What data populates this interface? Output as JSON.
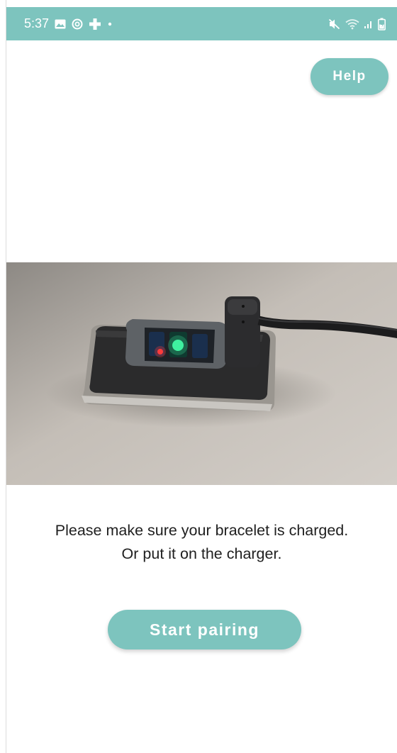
{
  "status_bar": {
    "time": "5:37",
    "left_icons": [
      "gallery-icon",
      "instagram-icon",
      "medical-cross-icon",
      "dot-icon"
    ],
    "right_icons": [
      "mute-icon",
      "wifi-icon",
      "signal-icon",
      "battery-icon"
    ]
  },
  "header": {
    "help_label": "Help"
  },
  "hero_image": {
    "subject": "bracelet-on-charger"
  },
  "message": {
    "line1": "Please make sure your bracelet is charged.",
    "line2": "Or put it on the charger."
  },
  "actions": {
    "start_label": "Start pairing"
  },
  "colors": {
    "accent": "#7dc4be",
    "text": "#1f1f1f",
    "background": "#ffffff"
  }
}
